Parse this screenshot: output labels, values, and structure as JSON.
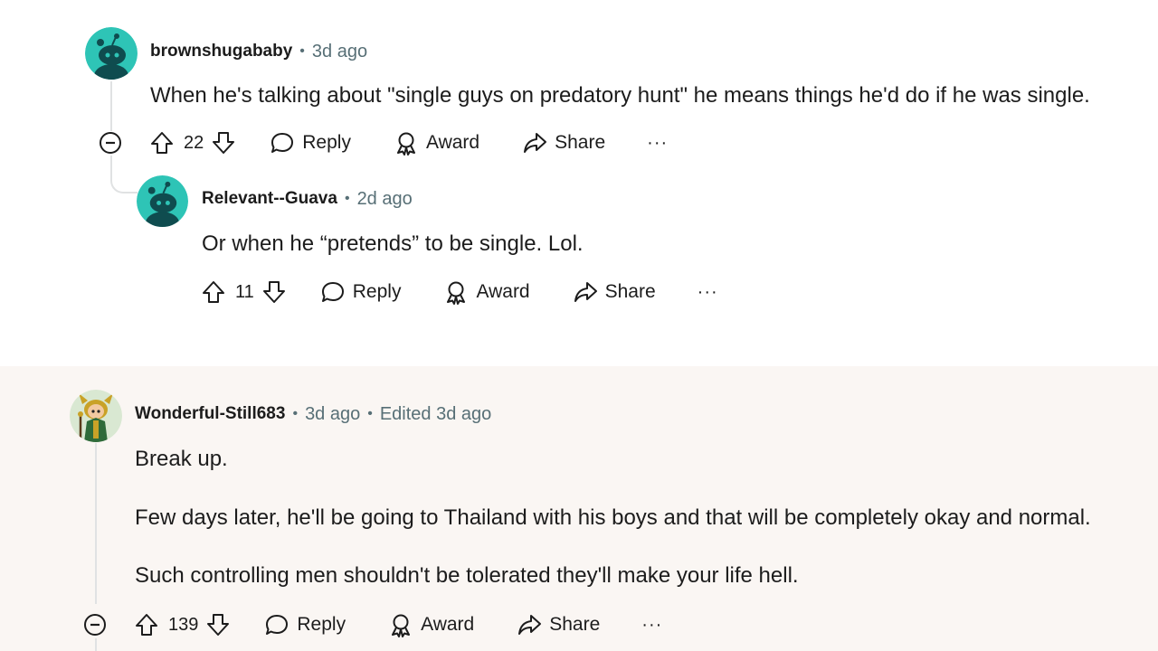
{
  "colors": {
    "meta_gray": "#576f76",
    "band_background": "#faf6f3",
    "snoo_teal": "#2ec4b6",
    "thread_line": "#e0e2e3"
  },
  "comments": [
    {
      "username": "brownshugababy",
      "age": "3d ago",
      "paragraphs": [
        "When he's talking about \"single guys on predatory hunt\" he means things he'd do if he was single."
      ],
      "score": "22",
      "reply_label": "Reply",
      "award_label": "Award",
      "share_label": "Share",
      "more_label": "···",
      "avatar_icon": "snoo-avatar-icon",
      "replies": [
        {
          "username": "Relevant--Guava",
          "age": "2d ago",
          "paragraphs": [
            "Or when he “pretends” to be single. Lol."
          ],
          "score": "11",
          "reply_label": "Reply",
          "award_label": "Award",
          "share_label": "Share",
          "more_label": "···",
          "avatar_icon": "snoo-avatar-icon"
        }
      ]
    },
    {
      "username": "Wonderful-Still683",
      "age": "3d ago",
      "edited": "Edited 3d ago",
      "paragraphs": [
        "Break up.",
        "Few days later, he'll be going to Thailand with his boys and that will be completely okay and normal.",
        "Such controlling men shouldn't be tolerated they'll make your life hell."
      ],
      "score": "139",
      "reply_label": "Reply",
      "award_label": "Award",
      "share_label": "Share",
      "more_label": "···",
      "avatar_icon": "custom-avatar-icon"
    }
  ]
}
